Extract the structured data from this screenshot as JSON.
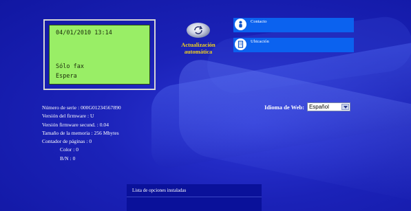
{
  "lcd": {
    "datetime": "04/01/2010 13:14",
    "mode": "Sólo fax",
    "status": "Espera"
  },
  "update": {
    "label_line1": "Actualización",
    "label_line2": "automática"
  },
  "buttons": {
    "contact": "Contacto",
    "location": "Ubicación"
  },
  "language": {
    "label": "Idioma de Web:",
    "selected": "Español"
  },
  "info": {
    "serial": "Número de serie : 000G01234567890",
    "firmware": "Versión del firmware : U",
    "firmware_secondary": "Versión firmware secund. : 0.04",
    "memory": "Tamaño de la memoria : 256 Mbytes",
    "page_counter": "Contador de páginas : 0",
    "color": "Color : 0",
    "bw": "B/N : 0"
  },
  "options": {
    "header": "Lista de opciones instaladas"
  },
  "colors": {
    "background": "#1a22b5",
    "lcd": "#99ee66",
    "button": "#0b62ef",
    "update_label": "#f2d21c"
  }
}
